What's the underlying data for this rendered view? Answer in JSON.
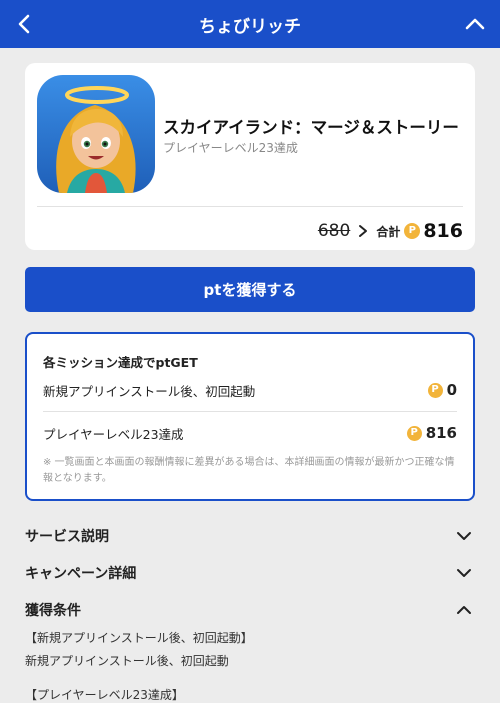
{
  "header": {
    "title": "ちょびリッチ"
  },
  "app": {
    "name": "スカイアイランド：マージ＆ストーリー",
    "subtitle": "プレイヤーレベル23達成",
    "old_points": "680",
    "total_label": "合計",
    "total_points": "816",
    "coin_symbol": "P"
  },
  "cta": {
    "label": "ptを獲得する"
  },
  "missions": {
    "title": "各ミッション達成でptGET",
    "items": [
      {
        "label": "新規アプリインストール後、初回起動",
        "points": "0"
      },
      {
        "label": "プレイヤーレベル23達成",
        "points": "816"
      }
    ],
    "note": "※ 一覧画面と本画面の報酬情報に差異がある場合は、本詳細画面の情報が最新かつ正確な情報となります。"
  },
  "sections": {
    "service": "サービス説明",
    "campaign": "キャンペーン詳細",
    "conditions": "獲得条件"
  },
  "conditions": {
    "cond1_heading": "【新規アプリインストール後、初回起動】",
    "cond1_body": "新規アプリインストール後、初回起動",
    "cond2_heading": "【プレイヤーレベル23達成】"
  },
  "colors": {
    "brand": "#1a4fc9",
    "coin": "#f2b43a",
    "background": "#ececec"
  }
}
